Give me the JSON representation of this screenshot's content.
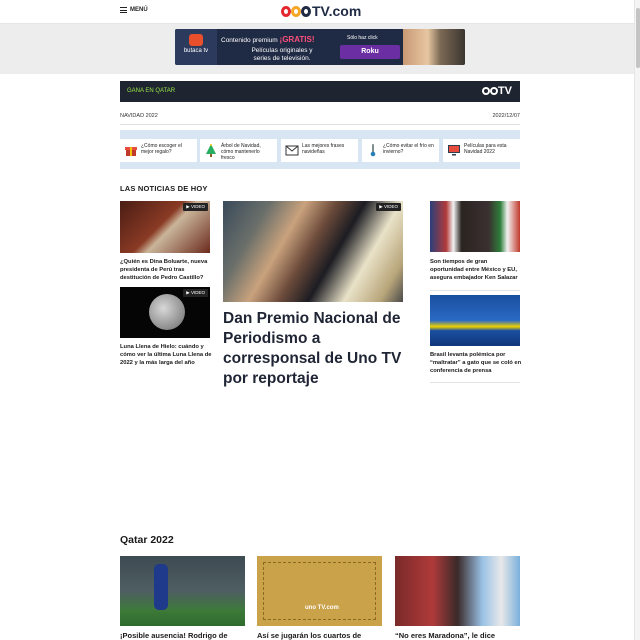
{
  "header": {
    "menu_label": "MENÚ",
    "logo_text": "TV.com"
  },
  "ad": {
    "brand": "butaca tv",
    "line1_prefix": "Contenido premium ",
    "line1_bold": "¡GRATIS!",
    "line2": "Películas originales y series de televisión.",
    "click_hint": "Sólo haz click",
    "button": "Roku"
  },
  "promo_bar": {
    "label": "GANA EN QATAR",
    "logo": "TV"
  },
  "section_row": {
    "left": "NAVIDAD 2022",
    "right": "2022/12/07"
  },
  "chips": [
    {
      "icon": "gift-icon",
      "text": "¿Cómo escoger el mejor regalo?"
    },
    {
      "icon": "christmas-tree-icon",
      "text": "Árbol de Navidad, cómo mantenerlo fresco"
    },
    {
      "icon": "envelope-icon",
      "text": "Las mejores frases navideñas"
    },
    {
      "icon": "thermometer-icon",
      "text": "¿Cómo evitar el frío en invierno?"
    },
    {
      "icon": "tv-icon",
      "text": "Películas para esta Navidad 2022"
    }
  ],
  "news": {
    "heading": "LAS NOTICIAS DE HOY",
    "video_badge": "VIDEO",
    "left": [
      {
        "caption": "¿Quién es Dina Boluarte, nueva presidenta de Perú tras destitución de Pedro Castillo?"
      },
      {
        "caption": "Luna Llena de Hielo: cuándo y cómo ver la última Luna Llena de 2022 y la más larga del año"
      }
    ],
    "main_title": "Dan Premio Nacional de Periodismo a corresponsal de Uno TV por reportaje",
    "right": [
      {
        "caption": "Son tiempos de gran oportunidad entre México y EU, asegura embajador Ken Salazar"
      },
      {
        "caption": "Brasil levanta polémica por “maltratar” a gato que se coló en conferencia de prensa"
      }
    ]
  },
  "qatar": {
    "heading": "Qatar 2022",
    "cards": [
      {
        "caption": "¡Posible ausencia! Rodrigo de"
      },
      {
        "caption": "Así se jugarán los cuartos de"
      },
      {
        "caption": "“No eres Maradona”, le dice"
      }
    ]
  }
}
